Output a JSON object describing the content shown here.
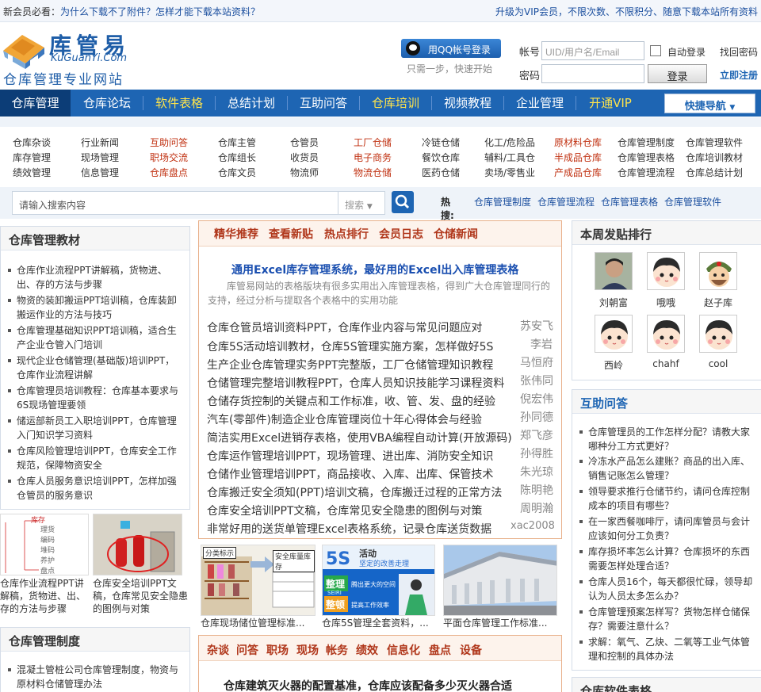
{
  "topbar": {
    "notice_prefix": "新会员必看：",
    "notice_text": "为什么下载不了附件？怎样才能下载本站资料？",
    "vip_text": "升级为VIP会员，不限次数、不限积分、随意下载本站所有资料"
  },
  "logo": {
    "name_cn": "库管易",
    "name_en": "KuGuanYi.Com",
    "slogan": "仓库管理专业网站"
  },
  "login": {
    "qq_button": "用QQ帐号登录",
    "qq_hint": "只需一步，快速开始",
    "account_label": "帐号",
    "account_placeholder": "UID/用户名/Email",
    "password_label": "密码",
    "remember_label": "自动登录",
    "forgot_link": "找回密码",
    "login_button": "登录",
    "register_link": "立即注册"
  },
  "nav": {
    "items": [
      "仓库管理",
      "仓库论坛",
      "软件表格",
      "总结计划",
      "互助问答",
      "仓库培训",
      "视频教程",
      "企业管理",
      "开通VIP"
    ],
    "quick_nav": "快捷导航"
  },
  "sublinks": {
    "columns": [
      [
        "仓库杂谈",
        "库存管理",
        "绩效管理"
      ],
      [
        "行业新闻",
        "现场管理",
        "信息管理"
      ],
      [
        "互助问答",
        "职场交流",
        "仓库盘点"
      ],
      [
        "仓库主管",
        "仓库组长",
        "仓库文员"
      ],
      [
        "仓管员",
        "收货员",
        "物流师"
      ],
      [
        "工厂仓储",
        "电子商务",
        "物流仓储"
      ],
      [
        "冷链仓储",
        "餐饮仓库",
        "医药仓储"
      ],
      [
        "化工/危险品",
        "辅料/工具仓",
        "卖场/零售业"
      ],
      [
        "原材料仓库",
        "半成品仓库",
        "产成品仓库"
      ],
      [
        "仓库管理制度",
        "仓库管理表格",
        "仓库管理流程"
      ],
      [
        "仓库管理软件",
        "仓库培训教材",
        "仓库总结计划"
      ]
    ]
  },
  "search": {
    "placeholder": "请输入搜索内容",
    "select_label": "搜索",
    "hot_label": "热搜:",
    "hot_keywords": [
      "仓库管理制度",
      "仓库管理流程",
      "仓库管理表格",
      "仓库管理软件"
    ]
  },
  "left_panel": {
    "title": "仓库管理教材",
    "items": [
      "仓库作业流程PPT讲解稿，货物进、出、存的方法与步骤",
      "物资的装卸搬运PPT培训稿，仓库装卸搬运作业的方法与技巧",
      "仓库管理基础知识PPT培训稿，适合生产企业仓管入门培训",
      "现代企业仓储管理(基础版)培训PPT，仓库作业流程讲解",
      "仓库管理员培训教程：仓库基本要求与6S现场管理要领",
      "储运部新员工入职培训PPT，仓库管理入门知识学习资料",
      "仓库风险管理培训PPT，仓库安全工作规范，保障物资安全",
      "仓库人员服务意识培训PPT，怎样加强仓管员的服务意识"
    ],
    "thumbs": [
      {
        "caption": "仓库作业流程PPT讲解稿，货物进、出、存的方法与步骤"
      },
      {
        "caption": "仓库安全培训PPT文稿，仓库常见安全隐患的图例与对策"
      }
    ],
    "diagram_words": [
      "库存",
      "理货",
      "编码",
      "堆码",
      "养护",
      "盘点"
    ],
    "title2": "仓库管理制度",
    "items2": [
      "混凝土管桩公司仓库管理制度，物资与原材料仓储管理办法"
    ]
  },
  "center": {
    "tabs": [
      "精华推荐",
      "查看新贴",
      "热点排行",
      "会员日志",
      "仓储新闻"
    ],
    "featured_title": "通用Excel库存管理系统，最好用的Excel出入库管理表格",
    "featured_desc": "库管易网站的表格版块有很多实用出入库管理表格，得到广大仓库管理同行的支持，经过分析与提取各个表格中的实用功能",
    "rows": [
      {
        "title": "仓库仓管员培训资料PPT，仓库作业内容与常见问题应对",
        "author": "苏安飞"
      },
      {
        "title": "仓库5S活动培训教材，仓库5S管理实施方案，怎样做好5S",
        "author": "李岩"
      },
      {
        "title": "生产企业仓库管理实务PPT完整版，工厂仓储管理知识教程",
        "author": "马恒府"
      },
      {
        "title": "仓储管理完整培训教程PPT，仓库人员知识技能学习课程资料",
        "author": "张伟同"
      },
      {
        "title": "仓储存货控制的关键点和工作标准，收、管、发、盘的经验",
        "author": "倪宏伟"
      },
      {
        "title": "汽车(零部件)制造企业仓库管理岗位十年心得体会与经验",
        "author": "孙同德"
      },
      {
        "title": "简洁实用Excel进销存表格，使用VBA编程自动计算(开放源码)",
        "author": "郑飞彦"
      },
      {
        "title": "仓库运作管理培训PPT，现场管理、进出库、消防安全知识",
        "author": "孙得胜"
      },
      {
        "title": "仓储作业管理培训PPT，商品接收、入库、出库、保管技术",
        "author": "朱光琼"
      },
      {
        "title": "仓库搬迁安全须知(PPT)培训文稿，仓库搬迁过程的正常方法",
        "author": "陈明艳"
      },
      {
        "title": "仓库安全培训PPT文稿，仓库常见安全隐患的图例与对策",
        "author": "周明瀚"
      },
      {
        "title": "非常好用的送货单管理Excel表格系统，记录仓库送货数据",
        "author": "xac2008"
      }
    ],
    "thumbs": [
      {
        "caption": "仓库现场储位管理标准..."
      },
      {
        "caption": "仓库5S管理全套资料，..."
      },
      {
        "caption": "平面仓库管理工作标准..."
      }
    ],
    "thumb_texts": {
      "shelf_tag1": "分类标示",
      "shelf_tag2": "安全库量库存",
      "fives_title": "活动",
      "fives_sub": "坚定的改善走理",
      "zhengli": "整理",
      "zhengli_en": "SEIRI",
      "zhengli_text": "腾出更大的空间",
      "zhengdun": "整顿",
      "zhengdun_text": "提高工作效率"
    },
    "tabs2": [
      "杂谈",
      "问答",
      "职场",
      "现场",
      "帐务",
      "绩效",
      "信息化",
      "盘点",
      "设备"
    ],
    "featured2": "仓库建筑灭火器的配置基准，仓库应该配备多少灭火器合适"
  },
  "right_panel": {
    "title": "本周发贴排行",
    "users": [
      "刘朝富",
      "哦哦",
      "赵子库",
      "西岭",
      "chahf",
      "cool"
    ],
    "title2": "互助问答",
    "questions": [
      "仓库管理员的工作怎样分配？请教大家哪种分工方式更好？",
      "冷冻水产品怎么建账？商品的出入库、销售记账怎么管理？",
      "领导要求推行仓储节约，请问仓库控制成本的项目有哪些？",
      "在一家西餐咖啡厅，请问库管员与会计应该如何分工负责？",
      "库存损坏率怎么计算？仓库损坏的东西需要怎样处理合适？",
      "仓库人员16个，每天都很忙碌，领导却认为人员太多怎么办？",
      "仓库管理预案怎样写？货物怎样仓储保存？需要注意什么？",
      "求解：氧气、乙炔、二氧等工业气体管理和控制的具体办法"
    ],
    "title3": "仓库软件表格"
  },
  "colors": {
    "nav_bg": "#1e65b3",
    "nav_active": "#0c3d77",
    "link_blue": "#1a4e9e",
    "accent_red": "#c03010",
    "tab_brown": "#b0361a"
  }
}
